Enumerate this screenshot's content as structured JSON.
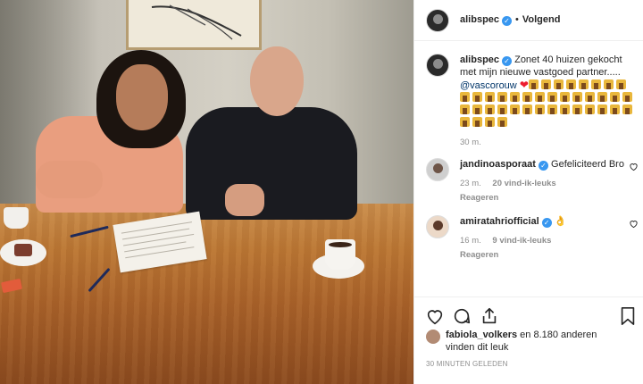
{
  "header": {
    "username": "alibspec",
    "separator": "•",
    "follow_status": "Volgend"
  },
  "caption": {
    "username": "alibspec",
    "text": "Zonet 40 huizen gekocht met mijn nieuwe vastgoed partner.....",
    "mention": "@vascorouw",
    "house_emoji_count": 40,
    "time": "30 m."
  },
  "comments": [
    {
      "username": "jandinoasporaat",
      "text": "Gefeliciteerd Bro",
      "time": "23 m.",
      "likes": "20 vind-ik-leuks",
      "reply": "Reageren"
    },
    {
      "username": "amiratahriofficial",
      "text": "",
      "emoji": "ok-hand",
      "time": "16 m.",
      "likes": "9 vind-ik-leuks",
      "reply": "Reageren"
    }
  ],
  "likes_line": {
    "username": "fabiola_volkers",
    "rest": "en 8.180 anderen",
    "line2": "vinden dit leuk"
  },
  "timestamp": "30 MINUTEN GELEDEN",
  "icons": [
    "heart-outline-icon",
    "comment-icon",
    "share-icon",
    "bookmark-icon",
    "verified-icon"
  ],
  "colors": {
    "verified": "#3897f0",
    "mention": "#003569",
    "muted": "#8e8e8e",
    "heart": "#ed1c2e"
  }
}
